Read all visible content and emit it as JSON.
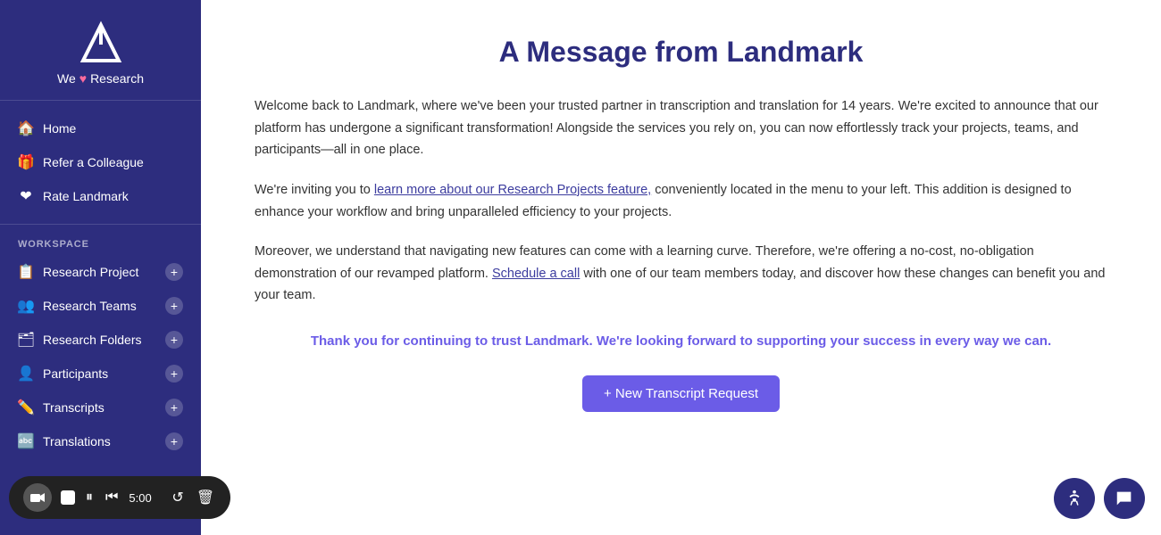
{
  "sidebar": {
    "brand_name": "We",
    "brand_heart": "♥",
    "brand_suffix": "Research",
    "nav_items": [
      {
        "id": "home",
        "label": "Home",
        "icon": "🏠"
      },
      {
        "id": "refer",
        "label": "Refer a Colleague",
        "icon": "🎁"
      },
      {
        "id": "rate",
        "label": "Rate Landmark",
        "icon": "❤"
      }
    ],
    "workspace_label": "WORKSPACE",
    "workspace_items": [
      {
        "id": "research-project",
        "label": "Research Project",
        "icon": "📋",
        "has_plus": true
      },
      {
        "id": "research-teams",
        "label": "Research Teams",
        "icon": "👥",
        "has_plus": true
      },
      {
        "id": "research-folders",
        "label": "Research Folders",
        "icon": "🗂",
        "has_plus": true
      },
      {
        "id": "participants",
        "label": "Participants",
        "icon": "👤",
        "has_plus": true
      },
      {
        "id": "transcripts",
        "label": "Transcripts",
        "icon": "✏️",
        "has_plus": true
      },
      {
        "id": "translations",
        "label": "Translations",
        "icon": "🔤",
        "has_plus": true
      }
    ]
  },
  "main": {
    "page_title": "A Message from Landmark",
    "paragraph1": "Welcome back to Landmark, where we've been your trusted partner in transcription and translation for 14 years. We're excited to announce that our platform has undergone a significant transformation! Alongside the services you rely on, you can now effortlessly track your projects, teams, and participants—all in one place.",
    "paragraph2_pre": "We're inviting you to ",
    "paragraph2_link": "learn more about our Research Projects feature,",
    "paragraph2_post": " conveniently located in the menu to your left. This addition is designed to enhance your workflow and bring unparalleled efficiency to your projects.",
    "paragraph3_pre": "Moreover, we understand that navigating new features can come with a learning curve. Therefore, we're offering a no-cost, no-obligation demonstration of our revamped platform. ",
    "paragraph3_link": "Schedule a call",
    "paragraph3_post": " with one of our team members today, and discover how these changes can benefit you and your team.",
    "thank_you_text": "Thank you for continuing to trust Landmark. We're looking forward to supporting your success in every way we can.",
    "cta_button": "+ New Transcript Request"
  },
  "media_controls": {
    "time": "5:00"
  },
  "accessibility_icon": "♿",
  "chat_icon": "💬"
}
